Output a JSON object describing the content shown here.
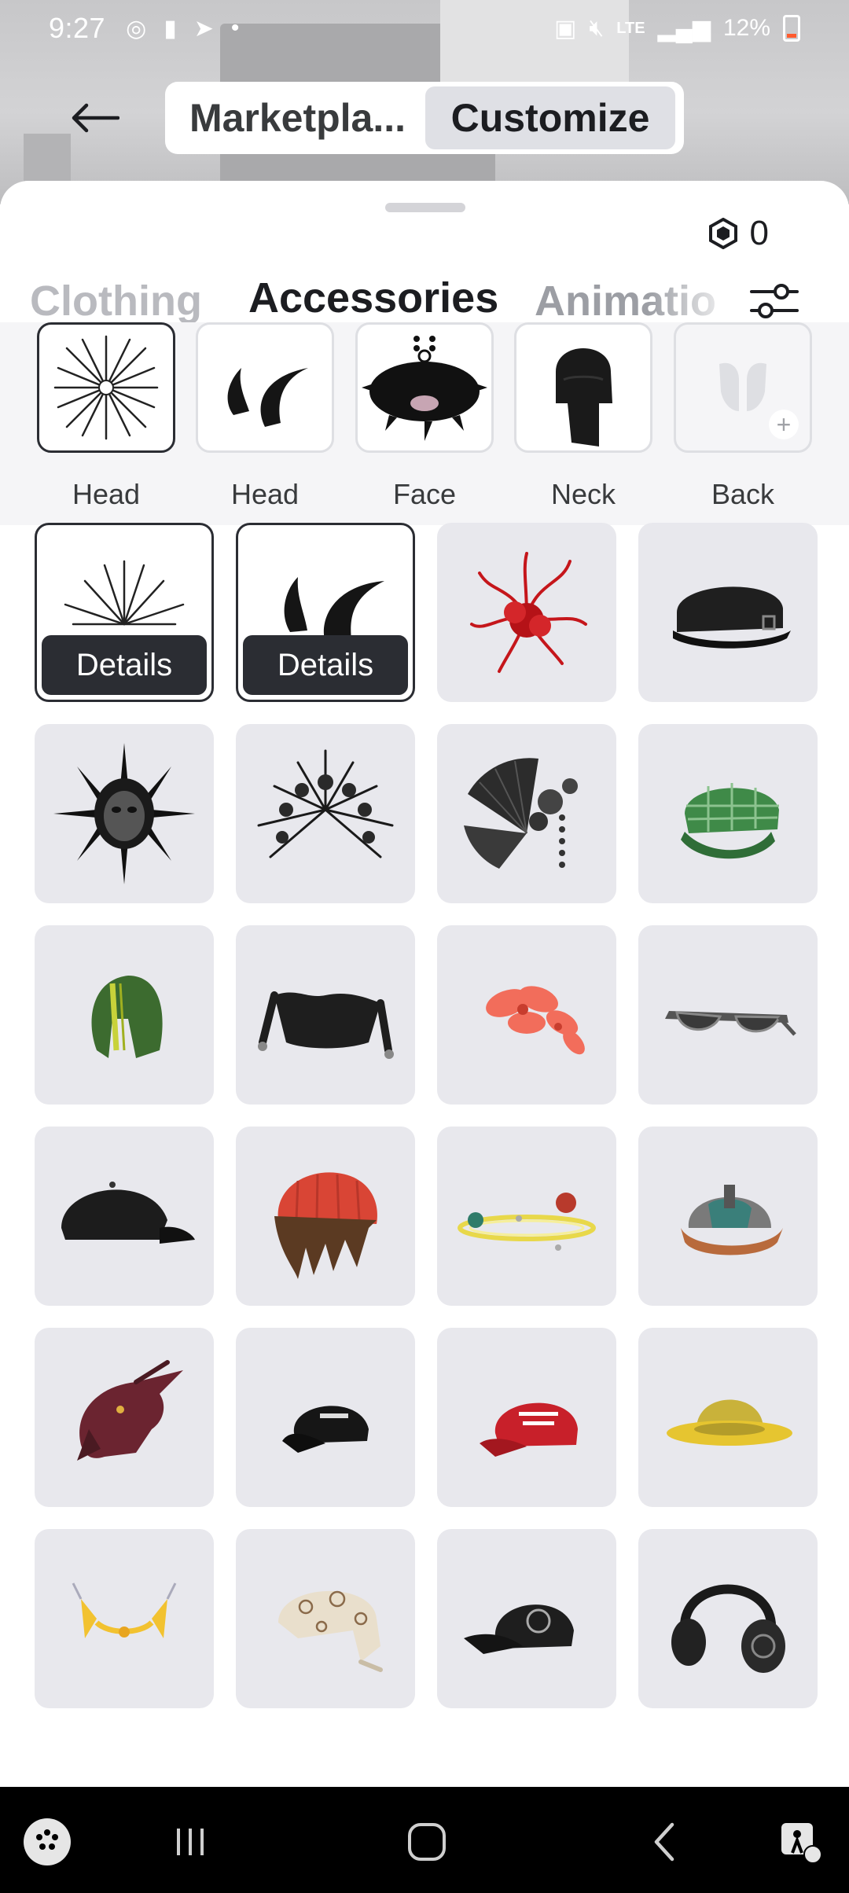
{
  "status_bar": {
    "time": "9:27",
    "battery_text": "12%"
  },
  "top_nav": {
    "segments": [
      {
        "label": "Marketpla...",
        "active": false
      },
      {
        "label": "Customize",
        "active": true
      }
    ]
  },
  "sheet": {
    "robux_balance": "0",
    "tabs": [
      {
        "label": "Clothing",
        "active": false
      },
      {
        "label": "Accessories",
        "active": true
      },
      {
        "label": "Animatio",
        "active": false
      }
    ]
  },
  "equipped_slots": [
    {
      "label": "Head",
      "icon": "spiky-burst-icon",
      "selected": true
    },
    {
      "label": "Head",
      "icon": "horns-icon",
      "selected": false
    },
    {
      "label": "Face",
      "icon": "spiked-mask-icon",
      "selected": false
    },
    {
      "label": "Neck",
      "icon": "black-hood-icon",
      "selected": false
    },
    {
      "label": "Back",
      "icon": "wings-placeholder-icon",
      "selected": false,
      "empty": true
    }
  ],
  "grid_items": [
    {
      "icon": "spiky-crown-icon",
      "selected": true,
      "action": "Details"
    },
    {
      "icon": "black-horns-icon",
      "selected": true,
      "action": "Details"
    },
    {
      "icon": "red-spider-lily-icon"
    },
    {
      "icon": "black-cadet-cap-icon"
    },
    {
      "icon": "spiked-mask-icon"
    },
    {
      "icon": "gothic-halo-icon"
    },
    {
      "icon": "black-fan-icon"
    },
    {
      "icon": "green-plaid-cap-icon"
    },
    {
      "icon": "green-hood-icon"
    },
    {
      "icon": "jester-hat-icon"
    },
    {
      "icon": "coral-flower-icon"
    },
    {
      "icon": "sunglasses-icon"
    },
    {
      "icon": "black-cap-icon"
    },
    {
      "icon": "hair-with-beanie-icon"
    },
    {
      "icon": "planet-ring-icon"
    },
    {
      "icon": "diving-helmet-icon"
    },
    {
      "icon": "dragon-head-icon"
    },
    {
      "icon": "roblox-cap-icon"
    },
    {
      "icon": "red-bulls-cap-icon"
    },
    {
      "icon": "yellow-bucket-hat-icon"
    },
    {
      "icon": "winged-circlet-icon"
    },
    {
      "icon": "paisley-bandana-icon"
    },
    {
      "icon": "jurassic-cap-icon"
    },
    {
      "icon": "headphones-icon"
    }
  ],
  "colors": {
    "accent": "#1c1d21",
    "card_bg": "#e8e8ed",
    "selected_border": "#2b2d33",
    "navbar": "#000000"
  }
}
